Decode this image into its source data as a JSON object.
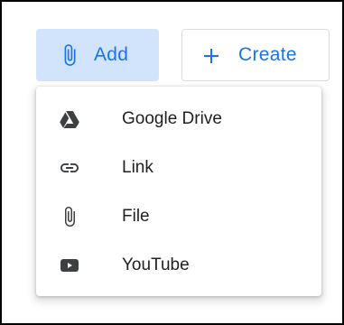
{
  "toolbar": {
    "add_label": "Add",
    "create_label": "Create"
  },
  "menu": {
    "items": [
      {
        "label": "Google Drive",
        "icon": "google-drive-icon"
      },
      {
        "label": "Link",
        "icon": "link-icon"
      },
      {
        "label": "File",
        "icon": "paperclip-icon"
      },
      {
        "label": "YouTube",
        "icon": "youtube-icon"
      }
    ]
  },
  "colors": {
    "accent": "#1a73e8",
    "add_button_bg": "#d2e3fc",
    "text": "#202124",
    "icon": "#3c4043"
  }
}
